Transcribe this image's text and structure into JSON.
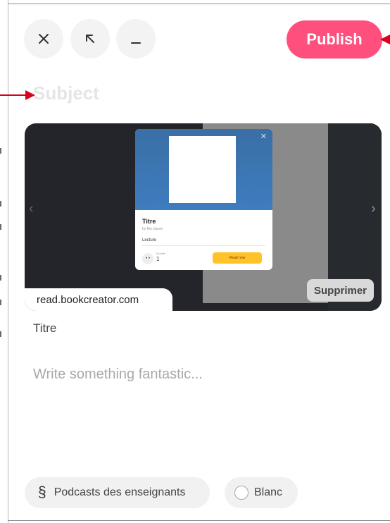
{
  "toolbar": {
    "close_icon": "close-icon",
    "expand_icon": "arrow-up-left-icon",
    "minimize_icon": "minimize-icon",
    "publish_label": "Publish",
    "publish_color": "#ff4f7d"
  },
  "composer": {
    "subject_placeholder": "Subject",
    "body_placeholder": "Write something fantastic..."
  },
  "link_preview": {
    "domain": "read.bookcreator.com",
    "remove_label": "Supprimer",
    "title": "Titre",
    "thumbnail": {
      "book_title": "Titre",
      "book_author": "by Ma classe",
      "section_label": "Lecture",
      "meta_label": "Modifié",
      "meta_value": "1",
      "read_button": "Read now",
      "accent_color": "#ffc229"
    }
  },
  "footer": {
    "category_icon": "section-sign-icon",
    "category_label": "Podcasts des enseignants",
    "color_label": "Blanc"
  },
  "annotations": {
    "arrow_color": "#d9001b"
  }
}
